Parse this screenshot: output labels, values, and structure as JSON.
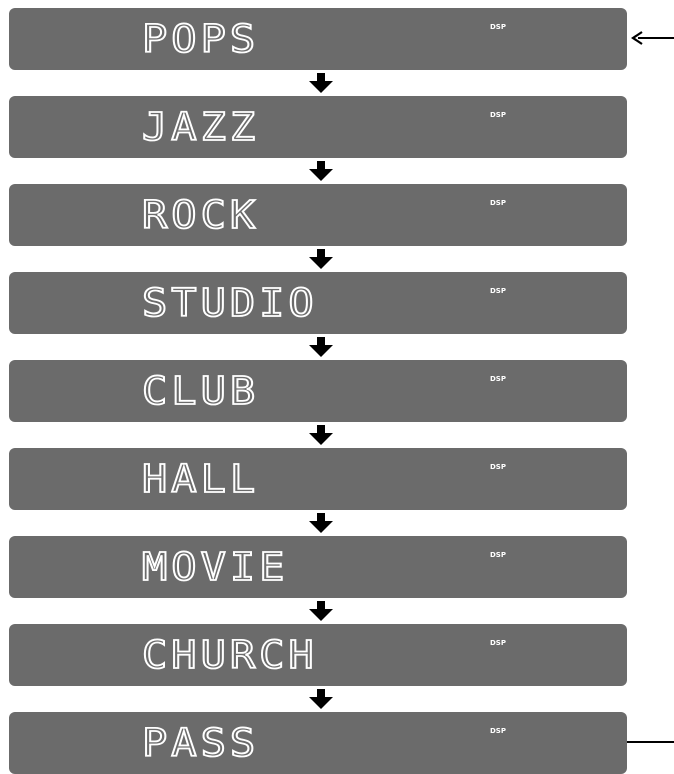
{
  "panels": [
    {
      "mode": "POPS",
      "indicator": "DSP"
    },
    {
      "mode": "JAZZ",
      "indicator": "DSP"
    },
    {
      "mode": "ROCK",
      "indicator": "DSP"
    },
    {
      "mode": "STUDIO",
      "indicator": "DSP"
    },
    {
      "mode": "CLUB",
      "indicator": "DSP"
    },
    {
      "mode": "HALL",
      "indicator": "DSP"
    },
    {
      "mode": "MOVIE",
      "indicator": "DSP"
    },
    {
      "mode": "CHURCH",
      "indicator": "DSP"
    },
    {
      "mode": "PASS",
      "indicator": "DSP"
    }
  ],
  "colors": {
    "panel": "#6b6b6b",
    "segment": "#ffffff",
    "arrow": "#000000"
  },
  "icons": {
    "down": "down-arrow-icon",
    "return_start": "return-arrow-icon",
    "return_end": "return-line"
  }
}
